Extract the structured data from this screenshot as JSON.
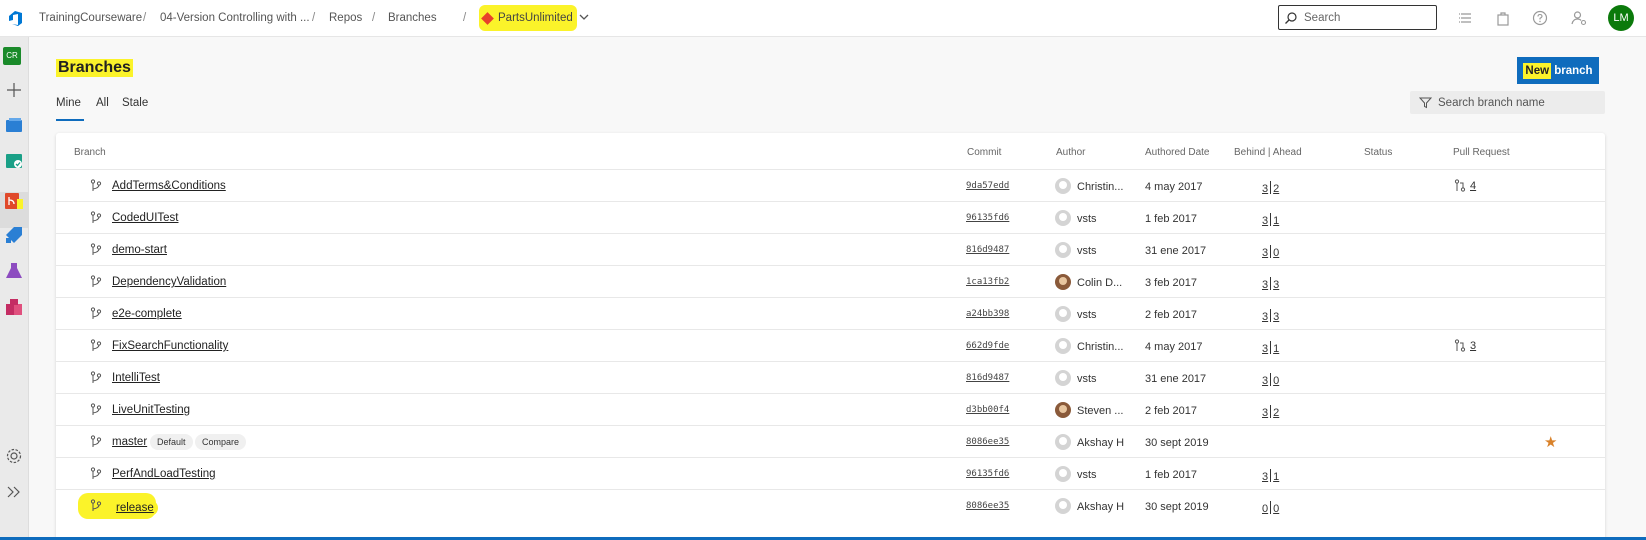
{
  "breadcrumb": {
    "org": "TrainingCourseware",
    "project": "04-Version Controlling with ...",
    "repos": "Repos",
    "branches": "Branches",
    "repo": "PartsUnlimited"
  },
  "search": {
    "placeholder": "Search"
  },
  "user": {
    "initials": "LM"
  },
  "rail": {
    "project_initials": "CR"
  },
  "page": {
    "title": "Branches",
    "new_branch_new": "New",
    "new_branch_rest": " branch",
    "tabs": [
      "Mine",
      "All",
      "Stale"
    ],
    "filter_placeholder": "Search branch name"
  },
  "table": {
    "headers": {
      "branch": "Branch",
      "commit": "Commit",
      "author": "Author",
      "date": "Authored Date",
      "behind_ahead": "Behind | Ahead",
      "status": "Status",
      "pull_request": "Pull Request"
    },
    "rows": [
      {
        "name": "AddTerms&Conditions",
        "commit": "9da57edd",
        "author": "Christin...",
        "date": "4 may 2017",
        "behind": "3",
        "ahead": "2",
        "pr": "4"
      },
      {
        "name": "CodedUITest",
        "commit": "96135fd6",
        "author": "vsts",
        "date": "1 feb 2017",
        "behind": "3",
        "ahead": "1"
      },
      {
        "name": "demo-start",
        "commit": "816d9487",
        "author": "vsts",
        "date": "31 ene 2017",
        "behind": "3",
        "ahead": "0"
      },
      {
        "name": "DependencyValidation",
        "commit": "1ca13fb2",
        "author": "Colin D...",
        "date": "3 feb 2017",
        "behind": "3",
        "ahead": "3"
      },
      {
        "name": "e2e-complete",
        "commit": "a24bb398",
        "author": "vsts",
        "date": "2 feb 2017",
        "behind": "3",
        "ahead": "3"
      },
      {
        "name": "FixSearchFunctionality",
        "commit": "662d9fde",
        "author": "Christin...",
        "date": "4 may 2017",
        "behind": "3",
        "ahead": "1",
        "pr": "3"
      },
      {
        "name": "IntelliTest",
        "commit": "816d9487",
        "author": "vsts",
        "date": "31 ene 2017",
        "behind": "3",
        "ahead": "0"
      },
      {
        "name": "LiveUnitTesting",
        "commit": "d3bb00f4",
        "author": "Steven ...",
        "date": "2 feb 2017",
        "behind": "3",
        "ahead": "2"
      },
      {
        "name": "master",
        "commit": "8086ee35",
        "author": "Akshay H",
        "date": "30 sept 2019",
        "badges": [
          "Default",
          "Compare"
        ]
      },
      {
        "name": "PerfAndLoadTesting",
        "commit": "96135fd6",
        "author": "vsts",
        "date": "1 feb 2017",
        "behind": "3",
        "ahead": "1"
      },
      {
        "name": "release",
        "commit": "8086ee35",
        "author": "Akshay H",
        "date": "30 sept 2019",
        "behind": "0",
        "ahead": "0"
      }
    ]
  },
  "colors": {
    "accent": "#0f6cbd",
    "highlight": "#fbf32a",
    "star": "#d9822b"
  }
}
